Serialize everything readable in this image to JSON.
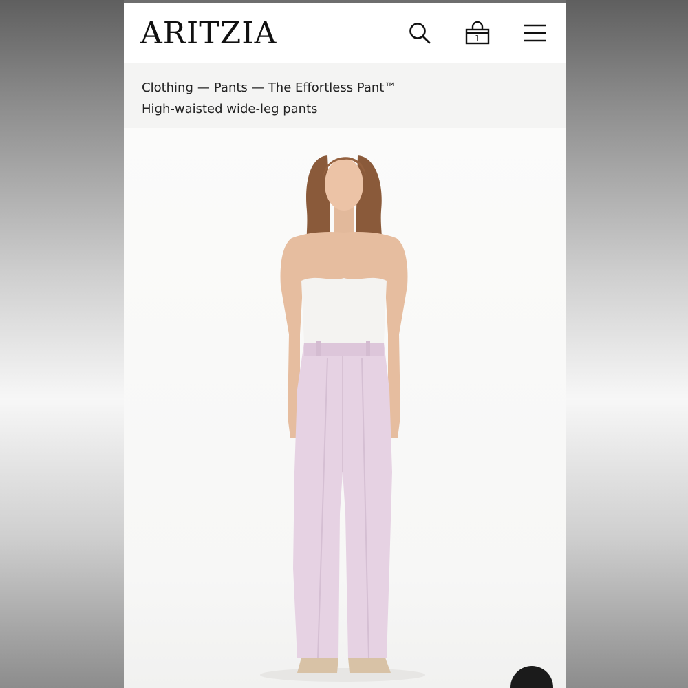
{
  "header": {
    "logo": "ARITZIA",
    "bag_count": "1",
    "icons": {
      "search": "search-icon",
      "bag": "shopping-bag-icon",
      "menu": "hamburger-menu-icon"
    }
  },
  "breadcrumb": {
    "items": [
      "Clothing",
      "Pants",
      "The Effortless Pant™"
    ],
    "separator": "—",
    "subtitle": "High-waisted wide-leg pants"
  },
  "product": {
    "pant_color": "#e6d2e3",
    "top_color": "#f4f3f1",
    "accent": "#111111"
  }
}
